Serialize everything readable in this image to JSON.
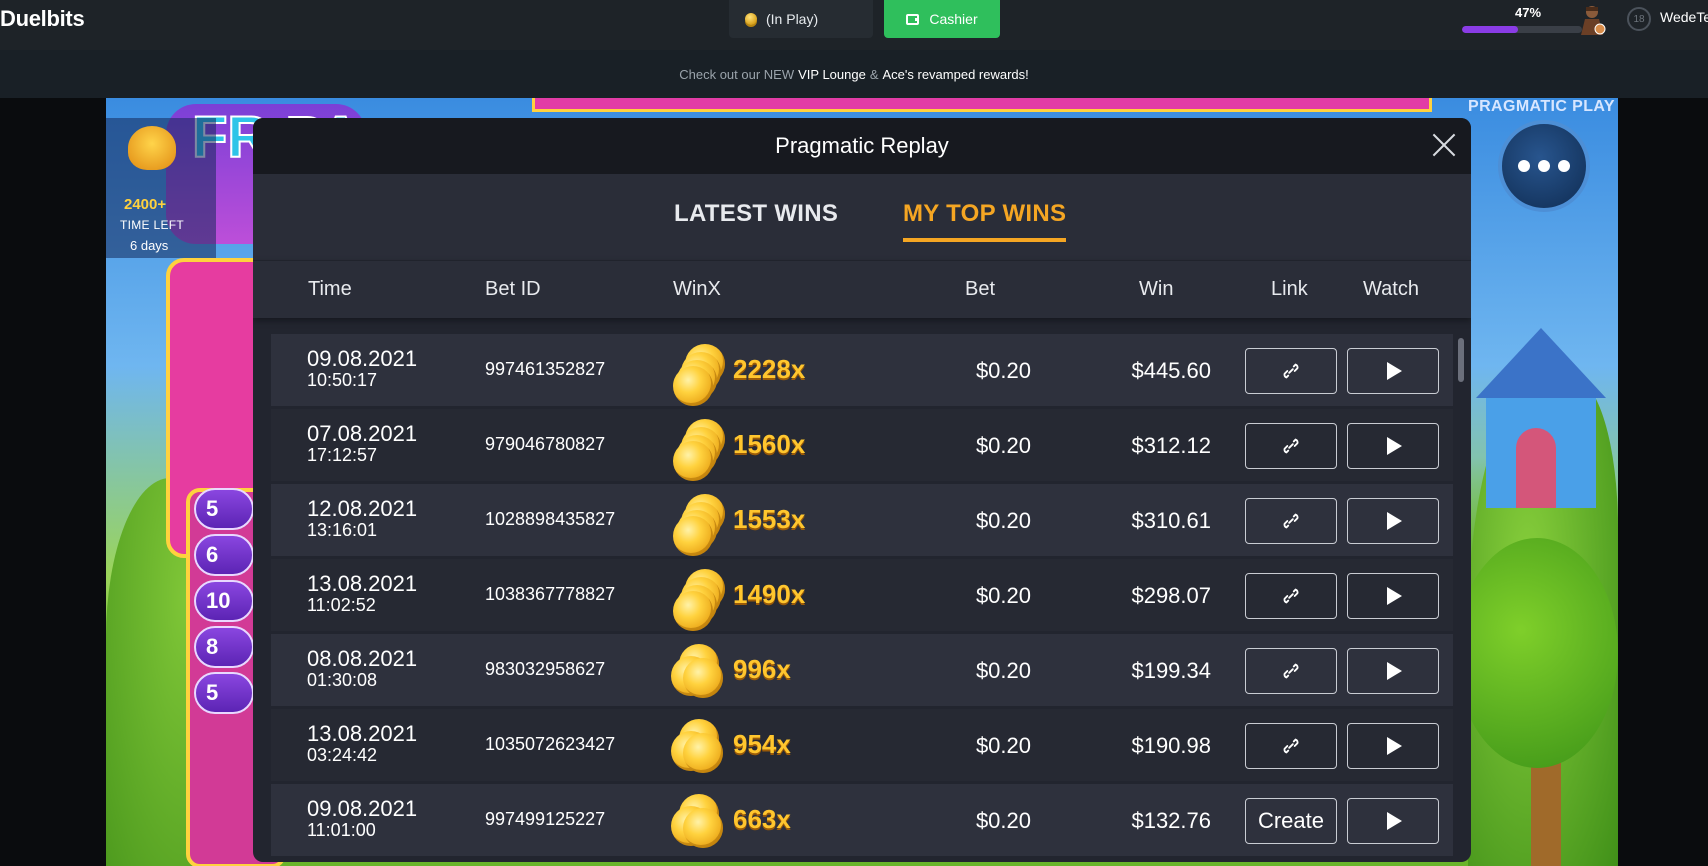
{
  "topbar": {
    "logo": "Duelbits",
    "balance_label": "(In Play)",
    "cashier_label": "Cashier",
    "xp_percent": "47%",
    "xp_progress": 0.47,
    "age_badge": "18",
    "username": "WedeTe",
    "icons": {
      "balance": "coin-icon",
      "cashier": "wallet-icon",
      "age": "age-restriction-icon"
    }
  },
  "promo": {
    "prefix": "Check out our NEW",
    "vip": "VIP Lounge",
    "amp": "&",
    "ace": "Ace's revamped rewards!"
  },
  "game": {
    "tournament_points": "2400+",
    "time_left_label": "TIME LEFT",
    "time_left_value": "6 days",
    "provider": "PRAGMATIC PLAY",
    "logo_text": "FR PA",
    "side_chips": [
      "5",
      "6",
      "10",
      "8",
      "5"
    ]
  },
  "modal": {
    "title": "Pragmatic Replay",
    "tabs": [
      {
        "label": "LATEST WINS",
        "active": false
      },
      {
        "label": "MY TOP WINS",
        "active": true
      }
    ],
    "columns": [
      "Time",
      "Bet ID",
      "WinX",
      "Bet",
      "Win",
      "Link",
      "Watch"
    ],
    "rows": [
      {
        "date": "09.08.2021",
        "time": "10:50:17",
        "bet_id": "997461352827",
        "winx": "2228x",
        "bet": "$0.20",
        "win": "$445.60",
        "link": "",
        "coin_stack": "large"
      },
      {
        "date": "07.08.2021",
        "time": "17:12:57",
        "bet_id": "979046780827",
        "winx": "1560x",
        "bet": "$0.20",
        "win": "$312.12",
        "link": "",
        "coin_stack": "large"
      },
      {
        "date": "12.08.2021",
        "time": "13:16:01",
        "bet_id": "1028898435827",
        "winx": "1553x",
        "bet": "$0.20",
        "win": "$310.61",
        "link": "",
        "coin_stack": "large"
      },
      {
        "date": "13.08.2021",
        "time": "11:02:52",
        "bet_id": "1038367778827",
        "winx": "1490x",
        "bet": "$0.20",
        "win": "$298.07",
        "link": "",
        "coin_stack": "large"
      },
      {
        "date": "08.08.2021",
        "time": "01:30:08",
        "bet_id": "983032958627",
        "winx": "996x",
        "bet": "$0.20",
        "win": "$199.34",
        "link": "",
        "coin_stack": "small"
      },
      {
        "date": "13.08.2021",
        "time": "03:24:42",
        "bet_id": "1035072623427",
        "winx": "954x",
        "bet": "$0.20",
        "win": "$190.98",
        "link": "",
        "coin_stack": "small"
      },
      {
        "date": "09.08.2021",
        "time": "11:01:00",
        "bet_id": "997499125227",
        "winx": "663x",
        "bet": "$0.20",
        "win": "$132.76",
        "link": "Create",
        "coin_stack": "small"
      }
    ]
  },
  "colors": {
    "accent": "#f5a623",
    "cashier": "#2fbf5c",
    "xp": "#8a3ce6",
    "winx": "#ffc62e"
  }
}
